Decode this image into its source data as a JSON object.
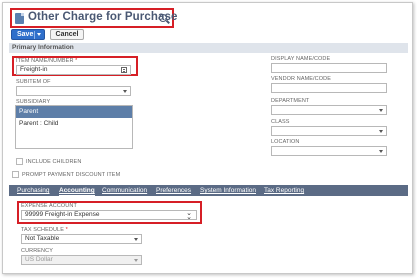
{
  "header": {
    "title": "Other Charge for Purchase"
  },
  "toolbar": {
    "save_label": "Save",
    "cancel_label": "Cancel"
  },
  "section": {
    "primary_information": "Primary Information"
  },
  "fields": {
    "item_name": {
      "label": "ITEM NAME/NUMBER",
      "required": "*",
      "value": "Freight-in"
    },
    "subitem_of": {
      "label": "SUBITEM OF",
      "value": ""
    },
    "subsidiary": {
      "label": "SUBSIDIARY",
      "options": [
        "Parent",
        "Parent : Child"
      ],
      "selected": "Parent"
    },
    "include_children": {
      "label": "INCLUDE CHILDREN"
    },
    "prompt_payment_discount": {
      "label": "PROMPT PAYMENT DISCOUNT ITEM"
    },
    "display_name": {
      "label": "DISPLAY NAME/CODE",
      "value": ""
    },
    "vendor_name": {
      "label": "VENDOR NAME/CODE",
      "value": ""
    },
    "department": {
      "label": "DEPARTMENT",
      "value": ""
    },
    "class": {
      "label": "CLASS",
      "value": ""
    },
    "location": {
      "label": "LOCATION",
      "value": ""
    }
  },
  "tabs": [
    {
      "label": "Purchasing"
    },
    {
      "label": "Accounting",
      "active": true
    },
    {
      "label": "Communication"
    },
    {
      "label": "Preferences"
    },
    {
      "label": "System Information"
    },
    {
      "label": "Tax Reporting"
    }
  ],
  "accounting": {
    "expense_account": {
      "label": "EXPENSE ACCOUNT",
      "value": "99999 Freight-in Expense"
    },
    "tax_schedule": {
      "label": "TAX SCHEDULE",
      "required": "*",
      "value": "Not Taxable"
    },
    "currency": {
      "label": "CURRENCY",
      "value": "US Dollar"
    }
  },
  "colors": {
    "accent_blue": "#2f6fcb",
    "tab_bar": "#5b6b85",
    "highlight_red": "#d61f26",
    "selected_option": "#5d7ea8"
  }
}
